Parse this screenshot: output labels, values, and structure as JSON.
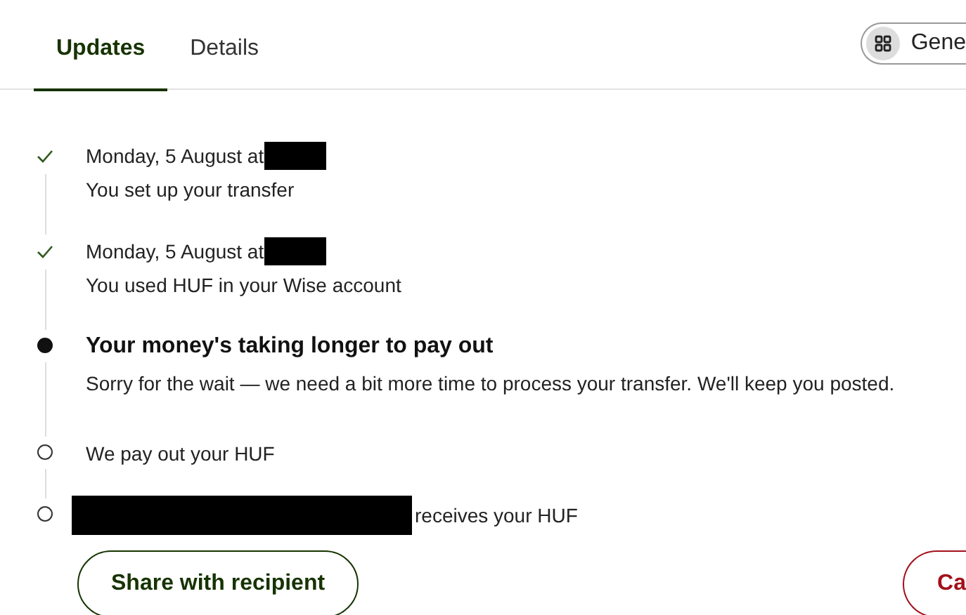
{
  "tabs": [
    {
      "label": "Updates",
      "selected": true
    },
    {
      "label": "Details",
      "selected": false
    }
  ],
  "menu_pill": {
    "label": "Gene"
  },
  "steps": [
    {
      "kind": "done",
      "title": "Monday, 5 August at",
      "redacted_before": false,
      "redacted_after": true,
      "text": "You set up your transfer"
    },
    {
      "kind": "done",
      "title": "Monday, 5 August at",
      "redacted_before": false,
      "redacted_after": true,
      "text": "You used HUF in your Wise account"
    },
    {
      "kind": "current",
      "title": "Your money's taking longer to pay out",
      "redacted_before": false,
      "redacted_after": false,
      "text": "Sorry for the wait — we need a bit more time to process your transfer. We'll keep you posted."
    },
    {
      "kind": "pending",
      "title": "We pay out your HUF",
      "redacted_before": false,
      "redacted_after": false
    },
    {
      "kind": "pending",
      "title": "receives your HUF",
      "redacted_before": true,
      "redacted_after": false
    }
  ],
  "buttons": [
    {
      "label": "Share with recipient",
      "kind": "secondary"
    },
    {
      "label": "Ca",
      "kind": "danger"
    }
  ]
}
